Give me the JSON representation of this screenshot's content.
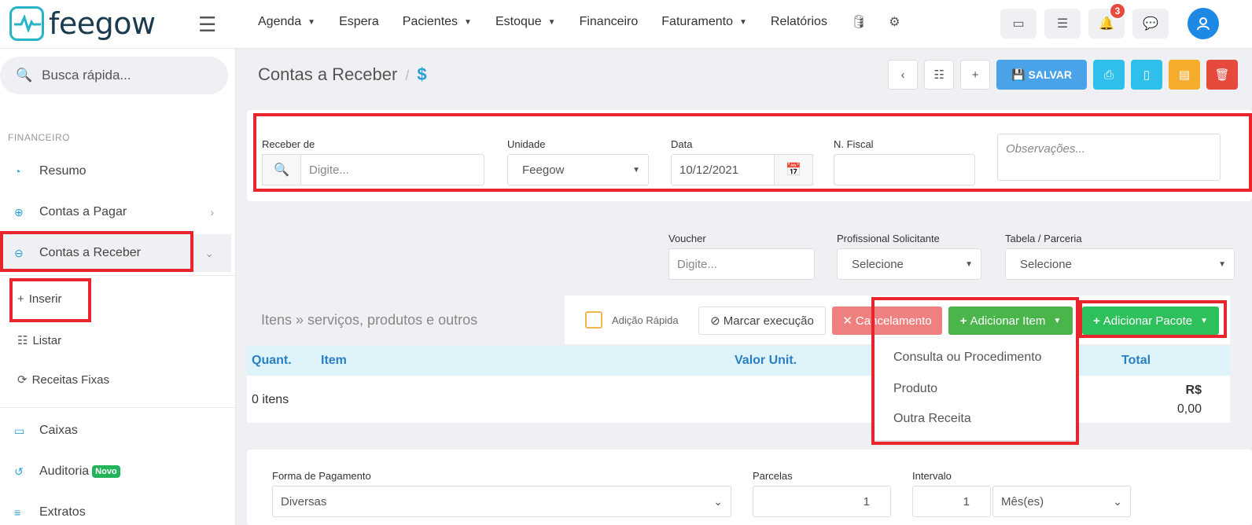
{
  "app": {
    "logo_text": "feegow"
  },
  "nav": [
    {
      "label": "Agenda",
      "caret": true
    },
    {
      "label": "Espera",
      "caret": false
    },
    {
      "label": "Pacientes",
      "caret": true
    },
    {
      "label": "Estoque",
      "caret": true
    },
    {
      "label": "Financeiro",
      "caret": false
    },
    {
      "label": "Faturamento",
      "caret": true
    },
    {
      "label": "Relatórios",
      "caret": false
    }
  ],
  "notifications_count": "3",
  "sidebar": {
    "search_placeholder": "Busca rápida...",
    "section": "FINANCEIRO",
    "items": [
      {
        "label": "Resumo"
      },
      {
        "label": "Contas a Pagar"
      },
      {
        "label": "Contas a Receber"
      }
    ],
    "subitems": [
      {
        "label": "Inserir"
      },
      {
        "label": "Listar"
      },
      {
        "label": "Receitas Fixas"
      }
    ],
    "bottom": [
      {
        "label": "Caixas"
      },
      {
        "label": "Auditoria"
      },
      {
        "label": "Extratos"
      }
    ],
    "novo_badge": "Novo"
  },
  "page": {
    "title": "Contas a Receber",
    "crumb_sep": "/",
    "crumb_icon": "$",
    "save_label": "SALVAR"
  },
  "form": {
    "receber_de_label": "Receber de",
    "receber_de_placeholder": "Digite...",
    "unidade_label": "Unidade",
    "unidade_value": "Feegow",
    "data_label": "Data",
    "data_value": "10/12/2021",
    "nfiscal_label": "N. Fiscal",
    "obs_placeholder": "Observações...",
    "voucher_label": "Voucher",
    "voucher_placeholder": "Digite...",
    "prof_label": "Profissional Solicitante",
    "prof_value": "Selecione",
    "tabela_label": "Tabela / Parceria",
    "tabela_value": "Selecione"
  },
  "items": {
    "header": "Itens » serviços, produtos e outros",
    "adicao_rapida": "Adição Rápida",
    "marcar_execucao": "Marcar execução",
    "cancelamento": "Cancelamento",
    "adicionar_item": "Adicionar Item",
    "adicionar_pacote": "Adicionar Pacote",
    "columns": {
      "quant": "Quant.",
      "item": "Item",
      "valor": "Valor Unit.",
      "total": "Total"
    },
    "count": "0 itens",
    "total_currency": "R$",
    "total_value": "0,00",
    "dropdown_options": [
      "Consulta ou Procedimento",
      "Produto",
      "Outra Receita"
    ]
  },
  "payment": {
    "forma_label": "Forma de Pagamento",
    "forma_value": "Diversas",
    "parcelas_label": "Parcelas",
    "parcelas_value": "1",
    "intervalo_label": "Intervalo",
    "intervalo_value": "1",
    "intervalo_unit": "Mês(es)"
  }
}
